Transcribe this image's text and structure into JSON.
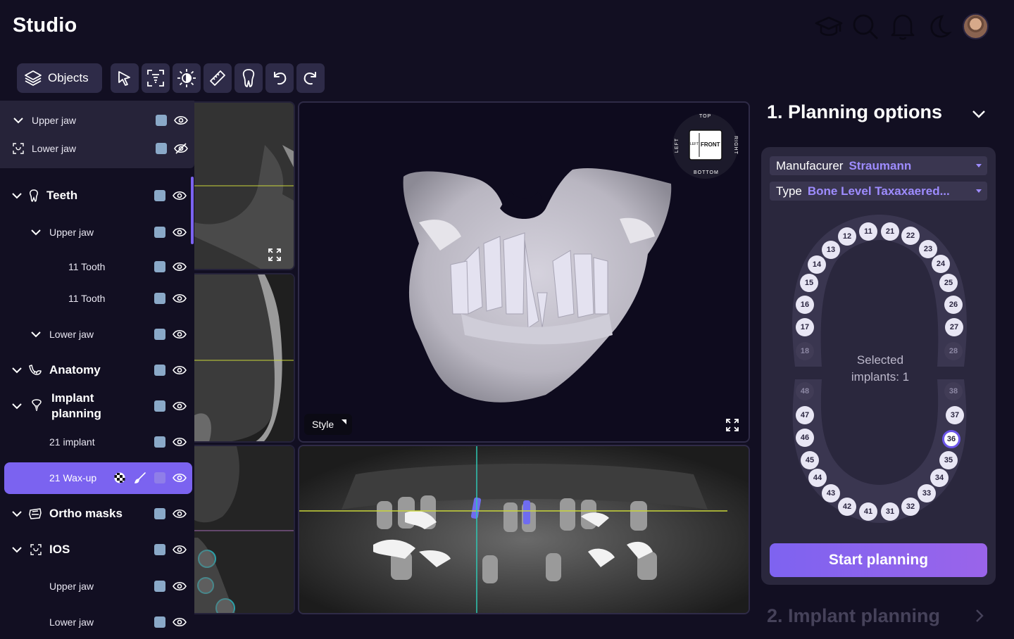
{
  "app": {
    "title": "Studio"
  },
  "header_icons": [
    "graduation-cap-icon",
    "search-icon",
    "bell-icon",
    "moon-icon",
    "avatar"
  ],
  "toolbar": {
    "objects_label": "Objects",
    "tools": [
      "select-cursor-icon",
      "scan-icon",
      "brightness-icon",
      "ruler-icon",
      "tooth-tool-icon",
      "undo-icon",
      "redo-icon"
    ]
  },
  "tree": {
    "top_upper_jaw": "Upper jaw",
    "top_lower_jaw": "Lower jaw",
    "teeth": "Teeth",
    "teeth_upper_jaw": "Upper jaw",
    "tooth_a": "11 Tooth",
    "tooth_b": "11 Tooth",
    "teeth_lower_jaw": "Lower jaw",
    "anatomy": "Anatomy",
    "implant_planning": "Implant planning",
    "implant_21": "21 implant",
    "waxup_21": "21 Wax-up",
    "ortho_masks": "Ortho masks",
    "ios": "IOS",
    "ios_upper_jaw": "Upper jaw",
    "ios_lower_jaw": "Lower jaw"
  },
  "viewer": {
    "style_label": "Style",
    "cube": {
      "front": "FRONT",
      "left_face": "LEFT",
      "top": "TOP",
      "bottom": "BOTTOM",
      "left": "LEFT",
      "right": "RIGHT"
    }
  },
  "panel": {
    "section1_title": "1. Planning options",
    "manufacturer_label": "Manufacurer",
    "manufacturer_value": "Straumann",
    "type_label": "Type",
    "type_value": "Bone Level Taxaxaered...",
    "selected_line1": "Selected",
    "selected_line2": "implants: 1",
    "start_button": "Start planning",
    "section2_title": "2. Implant planning"
  },
  "tooth_chart": {
    "upper": [
      "18",
      "17",
      "16",
      "15",
      "14",
      "13",
      "12",
      "11",
      "21",
      "22",
      "23",
      "24",
      "25",
      "26",
      "27",
      "28"
    ],
    "lower": [
      "48",
      "47",
      "46",
      "45",
      "44",
      "43",
      "42",
      "41",
      "31",
      "32",
      "33",
      "34",
      "35",
      "36",
      "37",
      "38"
    ],
    "disabled": [
      "18",
      "28",
      "48",
      "38"
    ],
    "selected": "36"
  },
  "colors": {
    "accent": "#7b63f0",
    "background": "#120f22",
    "panel": "#2a273d"
  }
}
